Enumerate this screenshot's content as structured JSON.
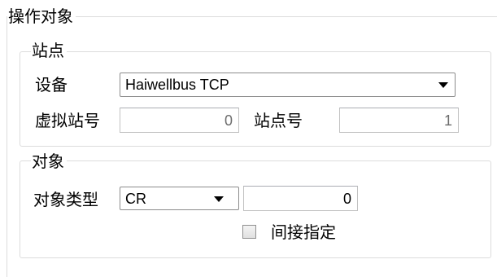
{
  "operation_target": {
    "title": "操作对象",
    "station": {
      "title": "站点",
      "device_label": "设备",
      "device_value": "Haiwellbus TCP",
      "virtual_station_label": "虚拟站号",
      "virtual_station_value": "0",
      "station_no_label": "站点号",
      "station_no_value": "1"
    },
    "object": {
      "title": "对象",
      "object_type_label": "对象类型",
      "object_type_value": "CR",
      "object_index_value": "0",
      "indirect_label": "间接指定",
      "indirect_checked": false
    }
  }
}
